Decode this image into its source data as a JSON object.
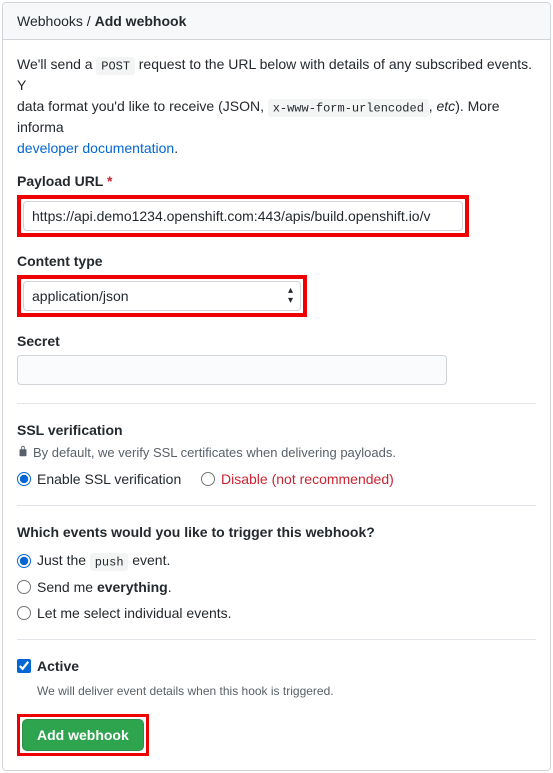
{
  "breadcrumb": {
    "root": "Webhooks",
    "sep": " / ",
    "current": "Add webhook"
  },
  "intro": {
    "t1": "We'll send a ",
    "code1": "POST",
    "t2": " request to the URL below with details of any subscribed events. Y",
    "t3": "data format you'd like to receive (JSON, ",
    "code2": "x-www-form-urlencoded",
    "t4": ", ",
    "em": "etc",
    "t5": "). More informa",
    "link": "developer documentation",
    "t6": "."
  },
  "payload": {
    "label": "Payload URL",
    "required": "*",
    "value": "https://api.demo1234.openshift.com:443/apis/build.openshift.io/v"
  },
  "contentType": {
    "label": "Content type",
    "value": "application/json"
  },
  "secret": {
    "label": "Secret"
  },
  "ssl": {
    "heading": "SSL verification",
    "note": "By default, we verify SSL certificates when delivering payloads.",
    "enable": "Enable SSL verification",
    "disablePrefix": "Disable ",
    "disableSuffix": "(not recommended)"
  },
  "events": {
    "heading": "Which events would you like to trigger this webhook?",
    "opt1a": "Just the ",
    "opt1code": "push",
    "opt1b": " event.",
    "opt2a": "Send me ",
    "opt2b": "everything",
    "opt2c": ".",
    "opt3": "Let me select individual events."
  },
  "active": {
    "label": "Active",
    "note": "We will deliver event details when this hook is triggered."
  },
  "submit": {
    "label": "Add webhook"
  }
}
